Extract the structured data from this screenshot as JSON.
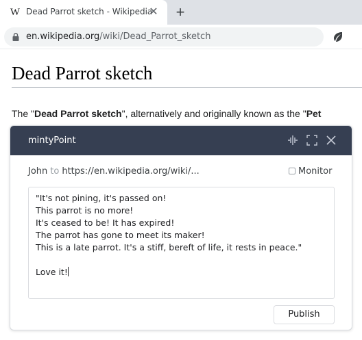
{
  "browser": {
    "tab": {
      "favicon": "W",
      "title": "Dead Parrot sketch - Wikipedia"
    },
    "url": {
      "host": "en.wikipedia.org",
      "path": "/wiki/Dead_Parrot_sketch"
    }
  },
  "page": {
    "title": "Dead Parrot sketch",
    "intro": {
      "pre": "The \"",
      "bold1": "Dead Parrot sketch",
      "mid": "\", alternatively and originally known as the \"",
      "bold2": "Pet"
    }
  },
  "popup": {
    "brand": "mintyPoint",
    "user": "John",
    "to_label": "to",
    "target_url": "https://en.wikipedia.org/wiki/...",
    "monitor_label": "Monitor",
    "monitor_checked": false,
    "comment": "\"It's not pining, it's passed on!\nThis parrot is no more!\nIt's ceased to be! It has expired!\nThe parrot has gone to meet its maker!\nThis is a late parrot. It's a stiff, bereft of life, it rests in peace.\"\n\nLove it!",
    "publish_label": "Publish"
  }
}
